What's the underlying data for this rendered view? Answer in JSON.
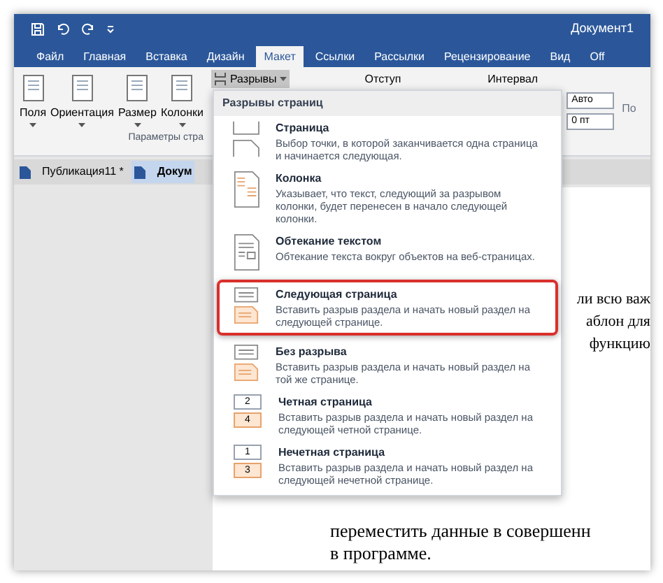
{
  "window": {
    "title": "Документ1"
  },
  "ribbon_tabs": [
    {
      "label": "Файл",
      "selected": false
    },
    {
      "label": "Главная",
      "selected": false
    },
    {
      "label": "Вставка",
      "selected": false
    },
    {
      "label": "Дизайн",
      "selected": false
    },
    {
      "label": "Макет",
      "selected": true
    },
    {
      "label": "Ссылки",
      "selected": false
    },
    {
      "label": "Рассылки",
      "selected": false
    },
    {
      "label": "Рецензирование",
      "selected": false
    },
    {
      "label": "Вид",
      "selected": false
    },
    {
      "label": "Off",
      "selected": false
    }
  ],
  "ribbon": {
    "buttons": [
      "Поля",
      "Ориентация",
      "Размер",
      "Колонки"
    ],
    "group_label": "Параметры стра",
    "breaks_button": "Разрывы",
    "indent_label": "Отступ",
    "spacing_label": "Интервал",
    "spacing_fields": [
      "Авто",
      "0 пт"
    ],
    "next_group": "По"
  },
  "doc_tabs": [
    {
      "label": "Публикация11 *",
      "selected": false
    },
    {
      "label": "Докум",
      "selected": true
    }
  ],
  "document": {
    "side_lines": [
      "ли всю важ",
      "аблон для",
      "функцию"
    ],
    "bottom_lines": [
      "переместить данные в совершенн",
      "в программе."
    ]
  },
  "menu": {
    "header": "Разрывы страниц",
    "items": [
      {
        "kind": "page",
        "title": "Страница",
        "description": "Выбор точки, в которой заканчивается одна страница и начинается следующая.",
        "highlighted": false
      },
      {
        "kind": "column",
        "title": "Колонка",
        "description": "Указывает, что текст, следующий за разрывом колонки, будет перенесен в начало следующей колонки.",
        "highlighted": false
      },
      {
        "kind": "wrap",
        "title": "Обтекание текстом",
        "description": "Обтекание текста вокруг объектов на веб-страницах.",
        "highlighted": false
      },
      {
        "kind": "next",
        "title": "Следующая страница",
        "description": "Вставить разрыв раздела и начать новый раздел на следующей странице.",
        "highlighted": true
      },
      {
        "kind": "continuous",
        "title": "Без разрыва",
        "description": "Вставить разрыв раздела и начать новый раздел на той же странице.",
        "highlighted": false
      },
      {
        "kind": "numbered",
        "title": "Четная страница",
        "description": "Вставить разрыв раздела и начать новый раздел на следующей четной странице.",
        "highlighted": false,
        "numbers": [
          "2",
          "4"
        ]
      },
      {
        "kind": "numbered",
        "title": "Нечетная страница",
        "description": "Вставить разрыв раздела и начать новый раздел на следующей нечетной странице.",
        "highlighted": false,
        "numbers": [
          "1",
          "3"
        ]
      }
    ]
  }
}
